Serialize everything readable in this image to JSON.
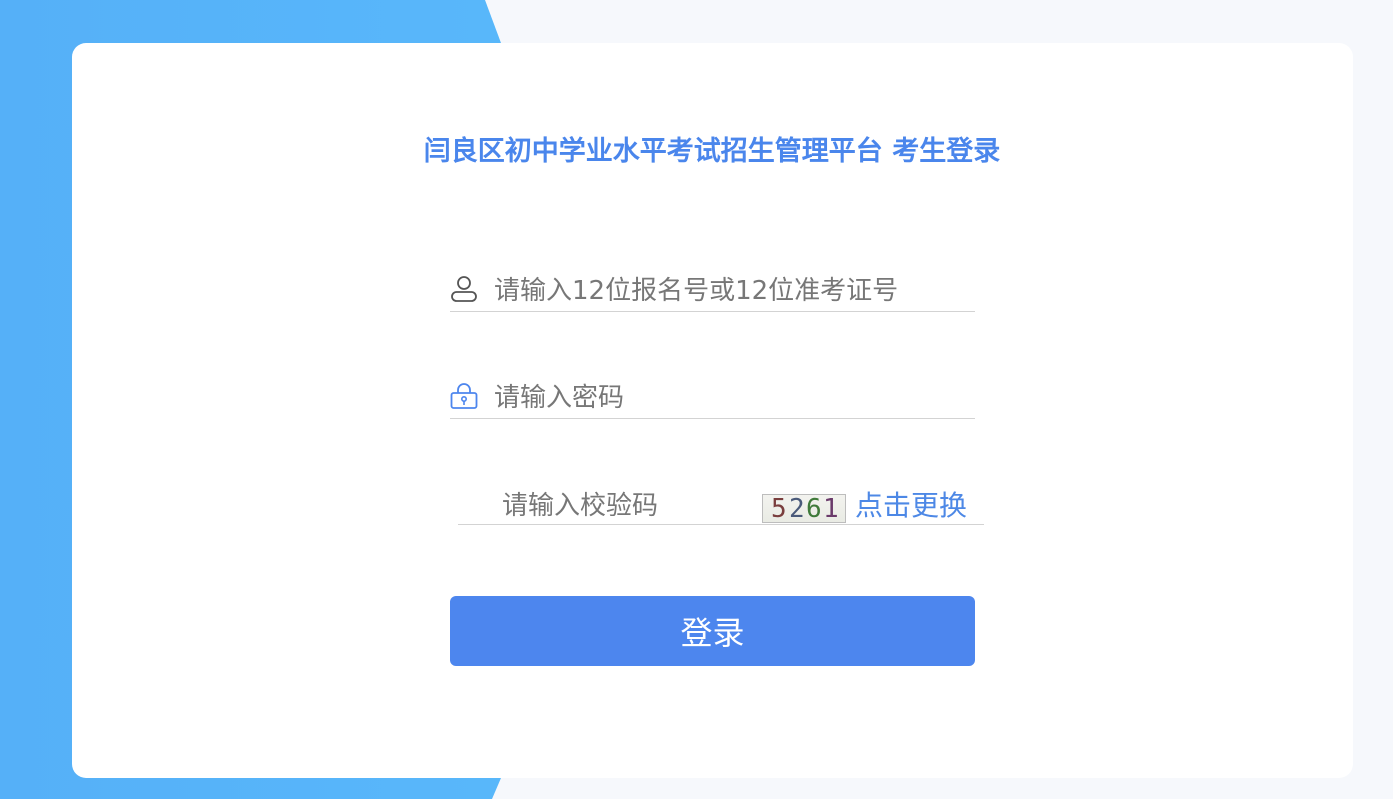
{
  "title": "闫良区初中学业水平考试招生管理平台 考生登录",
  "form": {
    "username": {
      "placeholder": "请输入12位报名号或12位准考证号",
      "value": "",
      "icon": "user-icon"
    },
    "password": {
      "placeholder": "请输入密码",
      "value": "",
      "icon": "lock-icon"
    },
    "captcha": {
      "placeholder": "请输入校验码",
      "value": "",
      "image_text": [
        "5",
        "2",
        "6",
        "1"
      ],
      "image_colors": [
        "#7a3e3e",
        "#4a5a7a",
        "#3f7a3a",
        "#6a3a6a"
      ],
      "refresh_label": "点击更换"
    },
    "login_label": "登录"
  },
  "colors": {
    "accent": "#4d86ee",
    "title": "#4a86ec",
    "link": "#4d88e6",
    "background_shape": "#55b0f8"
  }
}
